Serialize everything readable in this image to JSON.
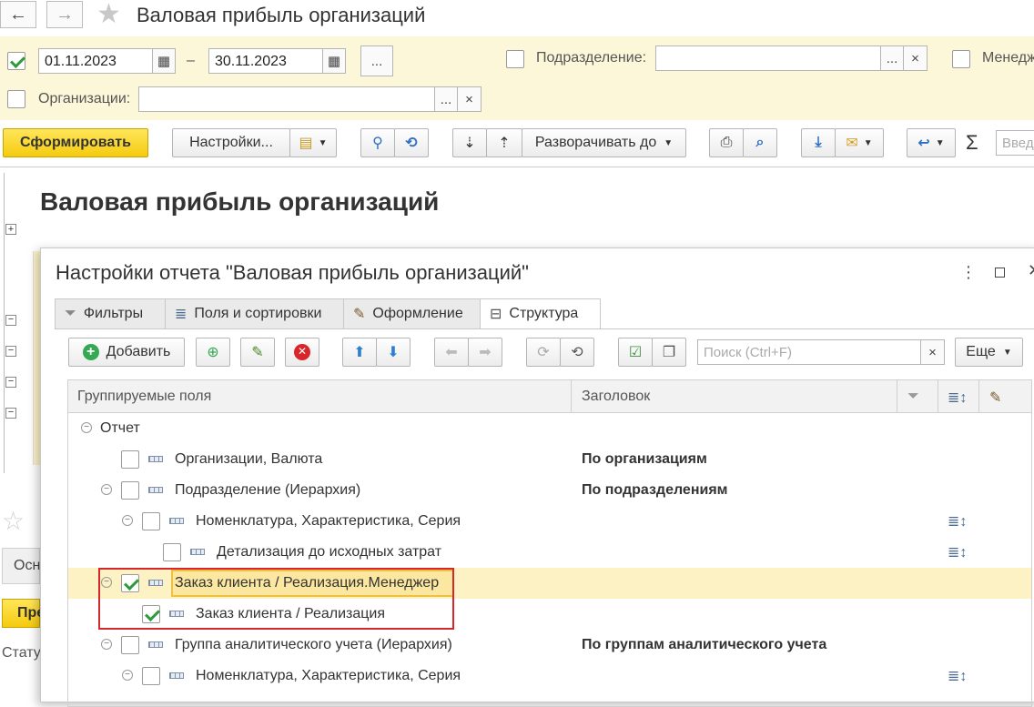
{
  "window": {
    "title": "Валовая прибыль организаций"
  },
  "filters": {
    "date_from": "01.11.2023",
    "date_dash": "–",
    "date_to": "30.11.2023",
    "period_btn": "...",
    "division_label": "Подразделение:",
    "manager_label": "Менедж",
    "org_label": "Организации:",
    "select_btn": "...",
    "clear_btn": "×"
  },
  "toolbar": {
    "generate": "Сформировать",
    "settings": "Настройки...",
    "expand": "Разворачивать до",
    "search_placeholder": "Введ"
  },
  "report": {
    "title": "Валовая прибыль организаций",
    "left_stub": "Осн",
    "left_btn": "Пре",
    "left_status": "Стату"
  },
  "dialog": {
    "title": "Настройки отчета \"Валовая прибыль организаций\"",
    "tabs": [
      "Фильтры",
      "Поля и сортировки",
      "Оформление",
      "Структура"
    ],
    "add_btn": "Добавить",
    "search_placeholder": "Поиск (Ctrl+F)",
    "more_btn": "Еще",
    "columns": {
      "fields": "Группируемые поля",
      "header": "Заголовок"
    },
    "rows": [
      {
        "text": "Отчет",
        "header": ""
      },
      {
        "text": "Организации, Валюта",
        "header": "По организациям"
      },
      {
        "text": "Подразделение (Иерархия)",
        "header": "По подразделениям"
      },
      {
        "text": "Номенклатура, Характеристика, Серия",
        "header": ""
      },
      {
        "text": "Детализация до исходных затрат",
        "header": ""
      },
      {
        "text": "Заказ клиента / Реализация.Менеджер",
        "header": ""
      },
      {
        "text": "Заказ клиента / Реализация",
        "header": ""
      },
      {
        "text": "Группа аналитического учета (Иерархия)",
        "header": "По группам аналитического учета"
      },
      {
        "text": "Номенклатура, Характеристика, Серия",
        "header": ""
      }
    ]
  },
  "colors": {
    "accent_yellow": "#f5cb0e",
    "highlight_row": "#fdf2c4",
    "selection_border": "#d9262b"
  }
}
